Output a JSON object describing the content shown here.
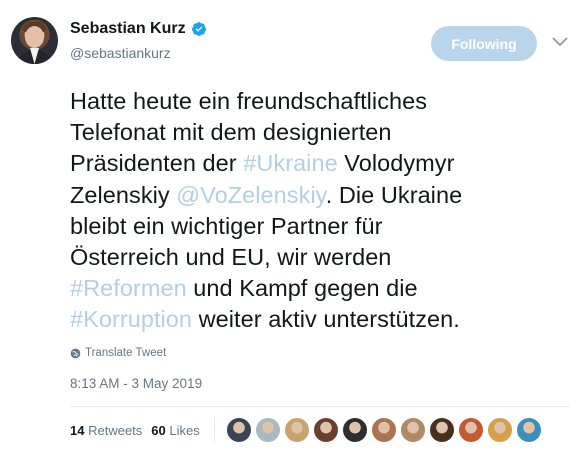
{
  "author": {
    "name": "Sebastian Kurz",
    "handle": "@sebastiankurz",
    "verified_icon": "verified-badge-icon"
  },
  "actions": {
    "follow_label": "Following"
  },
  "tweet": {
    "segments": [
      {
        "text": "Hatte heute ein freundschaftliches\nTelefonat mit dem designierten\nPräsidenten der ",
        "type": "text"
      },
      {
        "text": "#Ukraine",
        "type": "hashtag"
      },
      {
        "text": " Volodymyr\nZelenskiy ",
        "type": "text"
      },
      {
        "text": "@VoZelenskiy",
        "type": "mention"
      },
      {
        "text": ". Die Ukraine\nbleibt ein wichtiger Partner für\nÖsterreich und EU, wir werden\n",
        "type": "text"
      },
      {
        "text": "#Reformen",
        "type": "hashtag"
      },
      {
        "text": " und Kampf gegen die\n",
        "type": "text"
      },
      {
        "text": "#Korruption",
        "type": "hashtag"
      },
      {
        "text": " weiter aktiv unterstützen.",
        "type": "text"
      }
    ]
  },
  "translate_label": "Translate Tweet",
  "timestamp": "8:13 AM - 3 May 2019",
  "stats": {
    "retweets_count": "14",
    "retweets_label": "Retweets",
    "likes_count": "60",
    "likes_label": "Likes"
  },
  "likers": [
    {
      "color": "#3b4456"
    },
    {
      "color": "#aab8c2"
    },
    {
      "color": "#c9a36e"
    },
    {
      "color": "#6b3f2e"
    },
    {
      "color": "#2e2e2e"
    },
    {
      "color": "#a9744f"
    },
    {
      "color": "#b08968"
    },
    {
      "color": "#4a2f1e"
    },
    {
      "color": "#c25a34"
    },
    {
      "color": "#d4a04c"
    },
    {
      "color": "#3a8fbf"
    }
  ],
  "colors": {
    "link": "#b4cfe4",
    "follow_bg": "#b9d5eb",
    "secondary_text": "#657786",
    "verified": "#1da1f2"
  }
}
